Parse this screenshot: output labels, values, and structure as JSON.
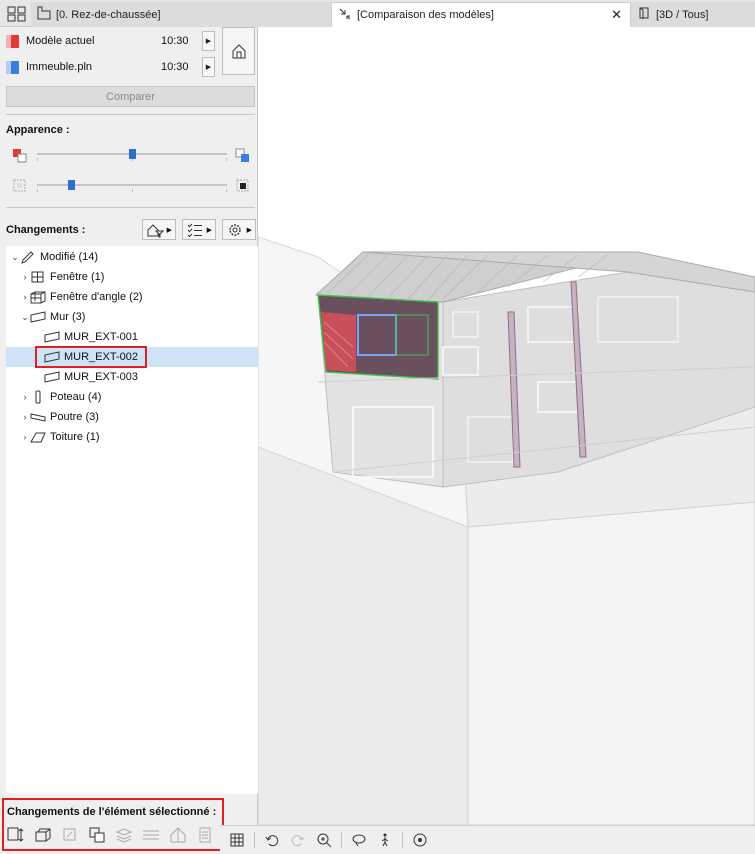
{
  "tabs": [
    {
      "label": "[0. Rez-de-chaussée]",
      "icon": "floor-plan-icon"
    },
    {
      "label": "[Comparaison des modèles]",
      "icon": "compare-arrows-icon"
    },
    {
      "label": "[3D / Tous]",
      "icon": "3d-view-icon"
    }
  ],
  "models": {
    "current": {
      "label": "Modèle actuel",
      "time": "10:30",
      "color": "#e53935"
    },
    "other": {
      "label": "Immeuble.pln",
      "time": "10:30",
      "color": "#3a7fe0"
    }
  },
  "compare_button": "Comparer",
  "appearance": {
    "title": "Apparence :",
    "slider1_value": 0.5,
    "slider2_value": 0.2
  },
  "changes": {
    "title": "Changements :",
    "tree": [
      {
        "label": "Modifié (14)",
        "level": 0,
        "expanded": true,
        "icon": "pencil-icon"
      },
      {
        "label": "Fenêtre (1)",
        "level": 1,
        "expanded": false,
        "icon": "window-icon"
      },
      {
        "label": "Fenêtre d'angle (2)",
        "level": 1,
        "expanded": false,
        "icon": "corner-window-icon"
      },
      {
        "label": "Mur (3)",
        "level": 1,
        "expanded": true,
        "icon": "wall-icon"
      },
      {
        "label": "MUR_EXT-001",
        "level": 2,
        "icon": "wall-icon"
      },
      {
        "label": "MUR_EXT-002",
        "level": 2,
        "icon": "wall-icon",
        "selected": true
      },
      {
        "label": "MUR_EXT-003",
        "level": 2,
        "icon": "wall-icon"
      },
      {
        "label": "Poteau (4)",
        "level": 1,
        "expanded": false,
        "icon": "column-icon"
      },
      {
        "label": "Poutre (3)",
        "level": 1,
        "expanded": false,
        "icon": "beam-icon"
      },
      {
        "label": "Toiture (1)",
        "level": 1,
        "expanded": false,
        "icon": "roof-icon"
      }
    ]
  },
  "selected_changes_title": "Changements de l'élément sélectionné :",
  "colors": {
    "accent": "#2f6fd0",
    "highlight": "#e02020",
    "selection": "#cfe3f7"
  }
}
